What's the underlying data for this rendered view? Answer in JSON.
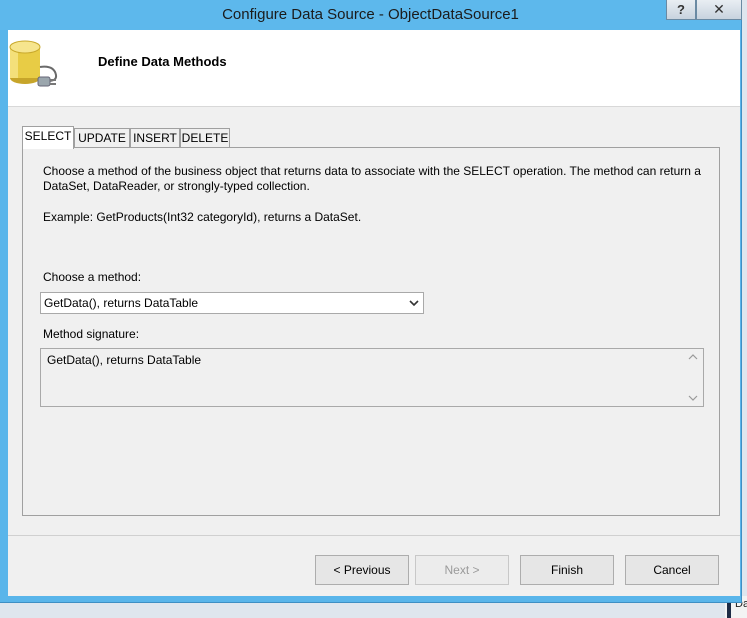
{
  "window": {
    "title": "Configure Data Source - ObjectDataSource1",
    "help_label": "?",
    "close_label": "✕"
  },
  "header": {
    "title": "Define Data Methods",
    "icon": "database-plug-icon"
  },
  "tabs": [
    {
      "label": "SELECT",
      "active": true
    },
    {
      "label": "UPDATE",
      "active": false
    },
    {
      "label": "INSERT",
      "active": false
    },
    {
      "label": "DELETE",
      "active": false
    }
  ],
  "panel": {
    "description": "Choose a method of the business object that returns data to associate with the SELECT operation. The method can return a DataSet, DataReader, or strongly-typed collection.",
    "example": "Example: GetProducts(Int32 categoryId), returns a DataSet.",
    "choose_label": "Choose a method:",
    "selected_method": "GetData(), returns DataTable",
    "signature_label": "Method signature:",
    "signature_value": "GetData(), returns DataTable"
  },
  "buttons": {
    "previous": "< Previous",
    "next": "Next >",
    "finish": "Finish",
    "cancel": "Cancel"
  },
  "background": {
    "scrap_text": "Da"
  }
}
